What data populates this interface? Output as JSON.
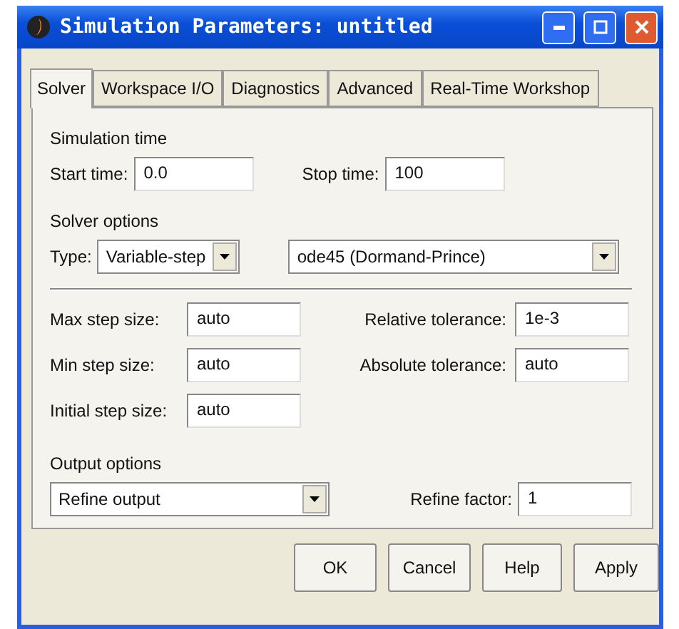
{
  "window": {
    "title": "Simulation Parameters: untitled"
  },
  "tabs": [
    {
      "label": "Solver",
      "selected": true
    },
    {
      "label": "Workspace I/O",
      "selected": false
    },
    {
      "label": "Diagnostics",
      "selected": false
    },
    {
      "label": "Advanced",
      "selected": false
    },
    {
      "label": "Real-Time Workshop",
      "selected": false
    }
  ],
  "simulation_time": {
    "label": "Simulation time",
    "fields": [
      {
        "label": "Start time:",
        "value": "0.0"
      },
      {
        "label": "Stop time:",
        "value": "100"
      }
    ]
  },
  "solver_options": {
    "label": "Solver options",
    "type_label": "Type:",
    "type_value": "Variable-step",
    "solver_value": "ode45 (Dormand-Prince)",
    "left_fields": [
      {
        "label": "Max step size:",
        "value": "auto"
      },
      {
        "label": "Min step size:",
        "value": "auto"
      },
      {
        "label": "Initial step size:",
        "value": "auto"
      }
    ],
    "right_fields": [
      {
        "label": "Relative tolerance:",
        "value": "1e-3"
      },
      {
        "label": "Absolute tolerance:",
        "value": "auto"
      }
    ]
  },
  "output_options": {
    "label": "Output options",
    "dropdown_value": "Refine output",
    "field": {
      "label": "Refine factor:",
      "value": "1"
    }
  },
  "buttons": [
    "OK",
    "Cancel",
    "Help",
    "Apply"
  ]
}
